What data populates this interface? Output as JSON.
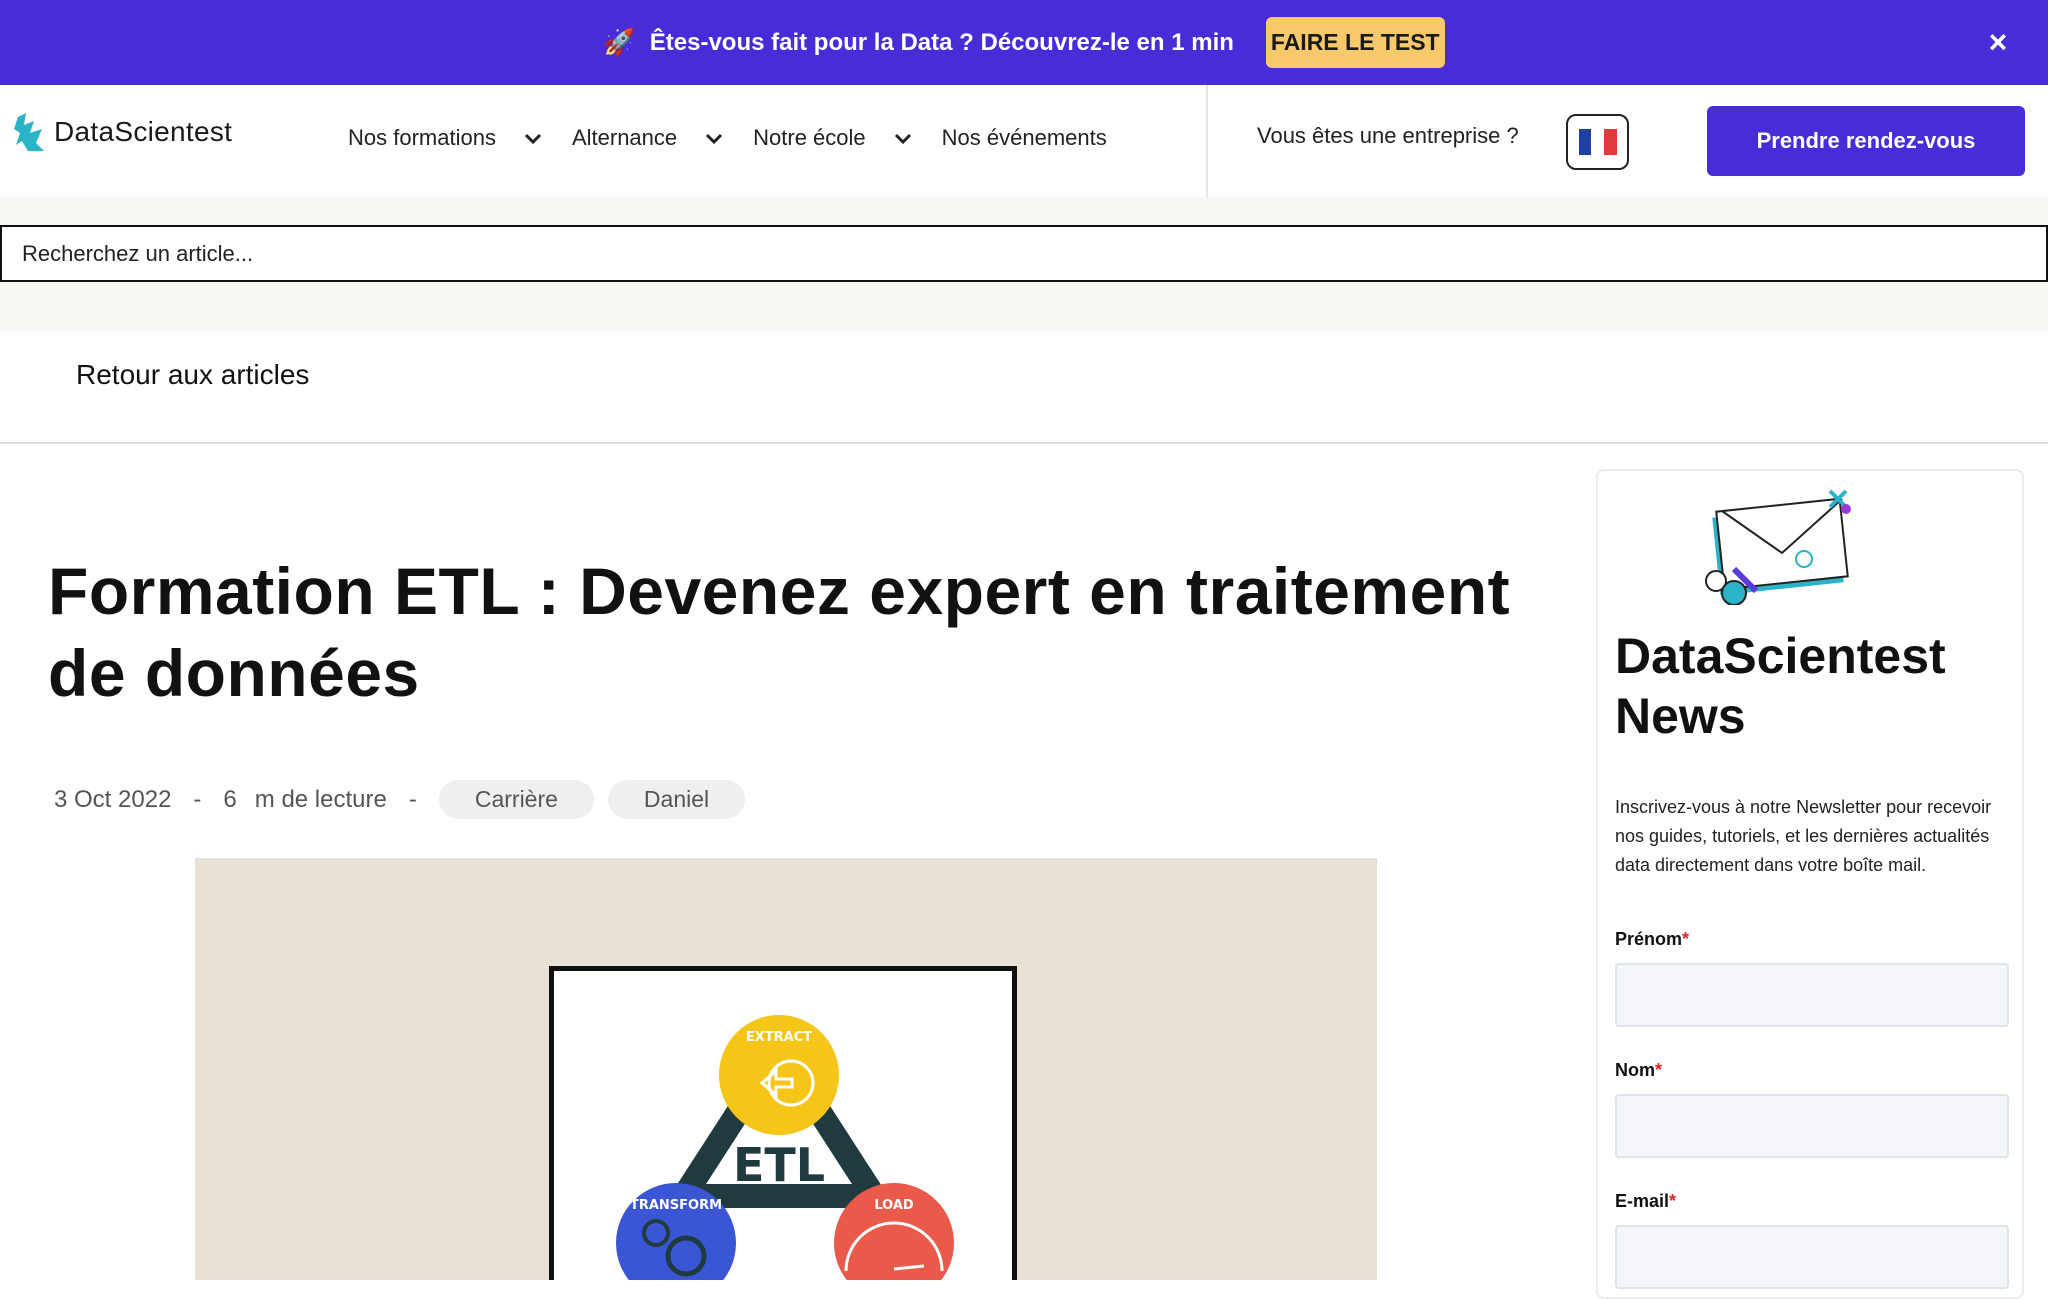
{
  "promo": {
    "text": "Êtes-vous fait pour la Data ? Découvrez-le en 1 min",
    "button": "FAIRE LE TEST",
    "close": "×"
  },
  "header": {
    "logo": "DataScientest",
    "nav": [
      {
        "label": "Nos formations",
        "has_dropdown": true
      },
      {
        "label": "Alternance",
        "has_dropdown": true
      },
      {
        "label": "Notre école",
        "has_dropdown": true
      },
      {
        "label": "Nos événements",
        "has_dropdown": false
      }
    ],
    "enterprise": "Vous êtes une entreprise ?",
    "cta": "Prendre rendez-vous"
  },
  "search": {
    "placeholder": "Recherchez un article..."
  },
  "back_link": "Retour aux articles",
  "article": {
    "title": "Formation ETL : Devenez expert en traitement de données",
    "date": "3 Oct 2022",
    "reading_number": "6",
    "reading_label": "m de lecture",
    "separator": "-",
    "tags": [
      "Carrière",
      "Daniel"
    ],
    "hero_labels": {
      "extract": "EXTRACT",
      "transform": "TRANSFORM",
      "load": "LOAD",
      "center": "ETL"
    }
  },
  "newsletter": {
    "title": "DataScientest News",
    "description": "Inscrivez-vous à notre Newsletter pour recevoir nos guides, tutoriels, et les dernières actualités data directement dans votre boîte mail.",
    "fields": [
      {
        "label": "Prénom",
        "required_mark": "*"
      },
      {
        "label": "Nom",
        "required_mark": "*"
      },
      {
        "label": "E-mail",
        "required_mark": "*"
      }
    ]
  },
  "colors": {
    "brand": "#4a2bd8",
    "promo_button": "#f7c96b"
  }
}
